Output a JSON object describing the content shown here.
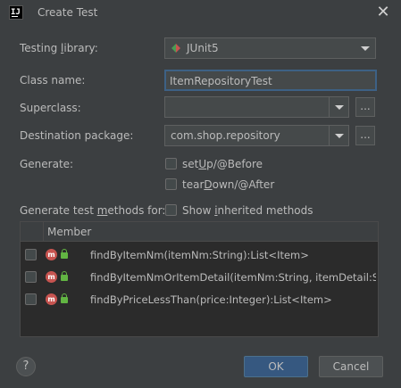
{
  "window": {
    "title": "Create Test",
    "logo_text": "IJ",
    "close_glyph": "✕"
  },
  "form": {
    "testing_library": {
      "label_pre": "Testing ",
      "label_u": "l",
      "label_post": "ibrary:",
      "value": "JUnit5"
    },
    "class_name": {
      "label": "Class name:",
      "value": "ItemRepositoryTest"
    },
    "superclass": {
      "label": "Superclass:",
      "value": "",
      "browse": "..."
    },
    "destination_package": {
      "label": "Destination package:",
      "value": "com.shop.repository",
      "browse": "..."
    },
    "generate": {
      "label": "Generate:",
      "setup": {
        "pre": "set",
        "u": "U",
        "post": "p/@Before",
        "checked": false
      },
      "teardown": {
        "pre": "tear",
        "u": "D",
        "post": "own/@After",
        "checked": false
      }
    },
    "generate_methods": {
      "label_pre": "Generate test ",
      "label_u": "m",
      "label_post": "ethods for:",
      "show_inherited": {
        "pre": "Show ",
        "u": "i",
        "post": "nherited methods",
        "checked": false
      }
    }
  },
  "table": {
    "header": "Member",
    "rows": [
      {
        "text": "findByItemNm(itemNm:String):List<Item>",
        "checked": false,
        "icon": "m"
      },
      {
        "text": "findByItemNmOrItemDetail(itemNm:String, itemDetail:String):List<Item>",
        "checked": false,
        "icon": "m"
      },
      {
        "text": "findByPriceLessThan(price:Integer):List<Item>",
        "checked": false,
        "icon": "m"
      }
    ]
  },
  "footer": {
    "help": "?",
    "ok": "OK",
    "cancel": "Cancel"
  },
  "colors": {
    "background": "#3c3f41",
    "primary_button": "#365880",
    "focus_border": "#3d6185",
    "method_icon": "#c75450",
    "lock_icon": "#62b543"
  }
}
